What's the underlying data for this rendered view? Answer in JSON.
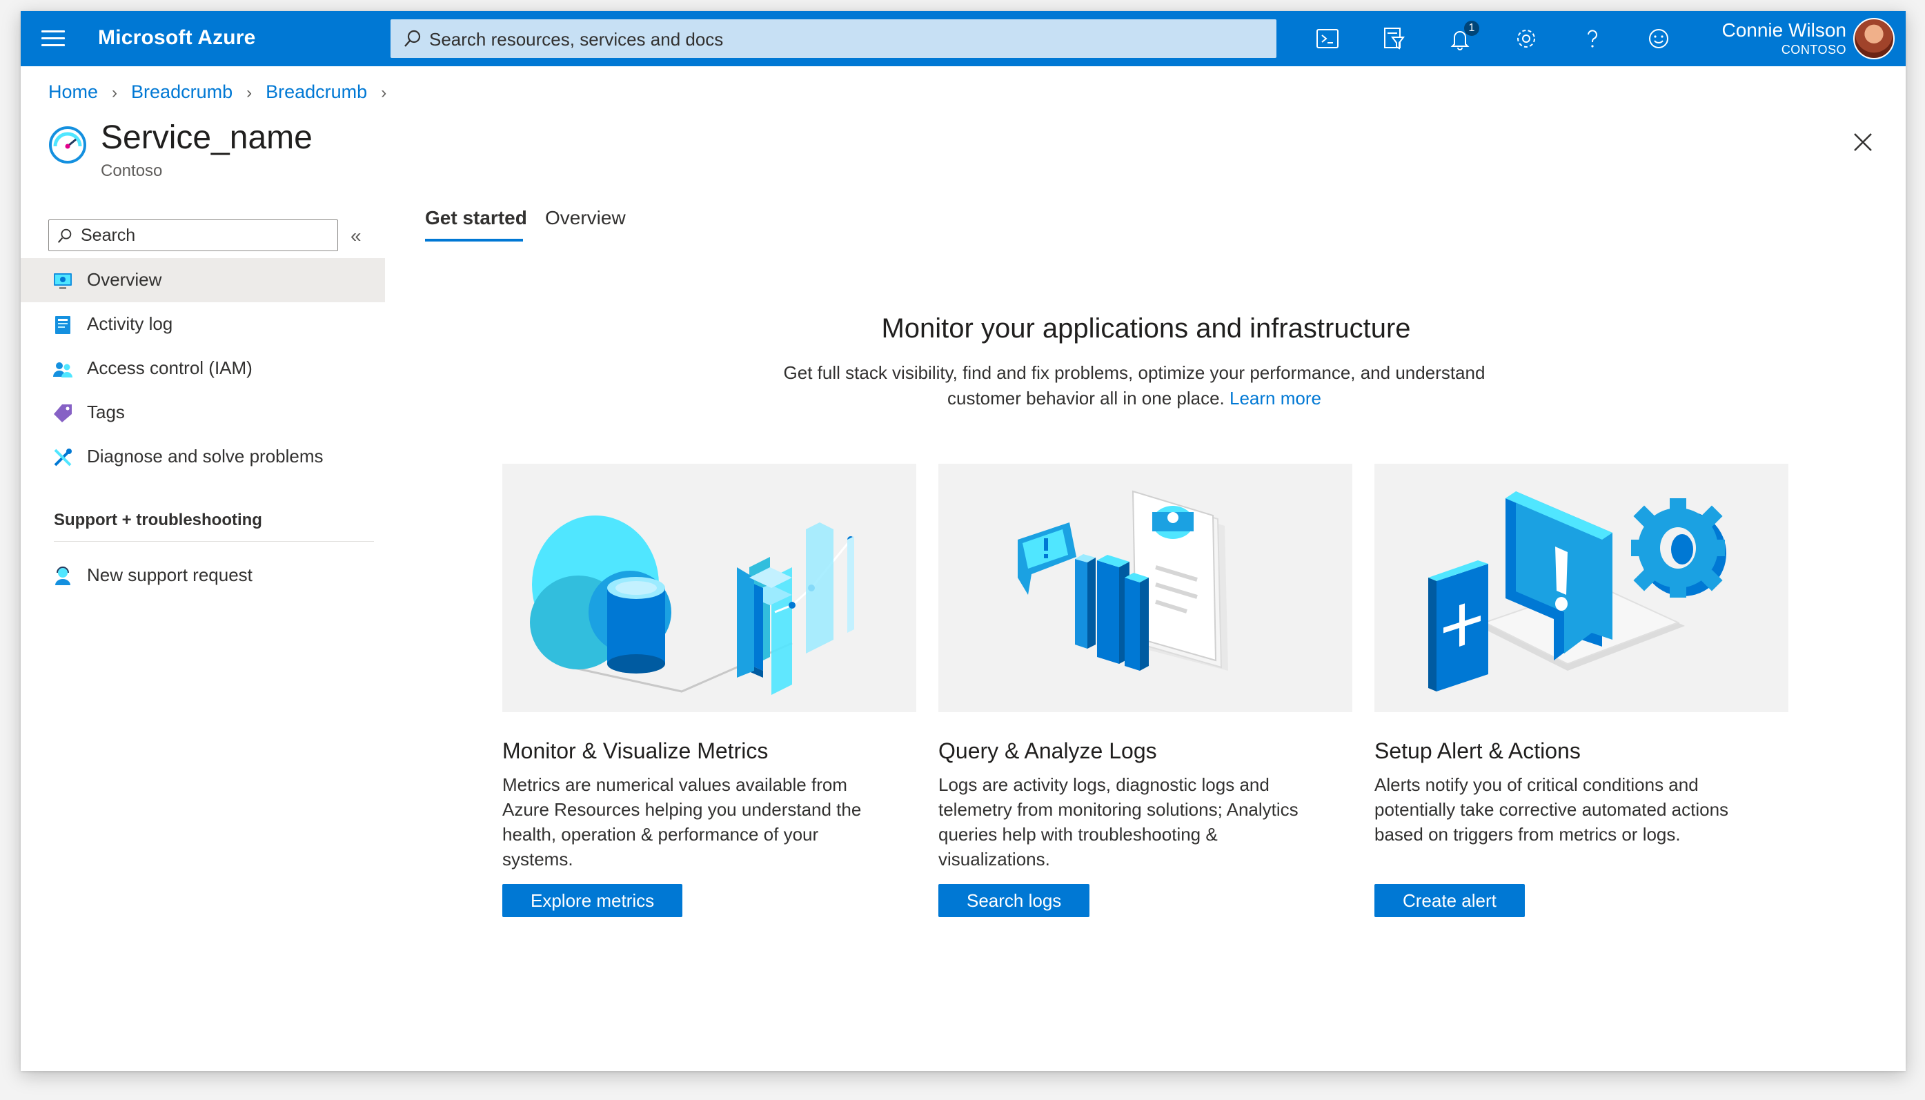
{
  "topbar": {
    "brand": "Microsoft Azure",
    "search_placeholder": "Search resources, services and docs",
    "notifications_count": "1",
    "user_name": "Connie Wilson",
    "user_org": "CONTOSO",
    "icons": [
      "cloud-shell-icon",
      "directory-filter-icon",
      "bell-icon",
      "gear-icon",
      "help-icon",
      "feedback-smiley-icon"
    ]
  },
  "breadcrumb": {
    "items": [
      "Home",
      "Breadcrumb",
      "Breadcrumb"
    ]
  },
  "resource": {
    "title": "Service_name",
    "subtitle": "Contoso"
  },
  "sidebar": {
    "search_placeholder": "Search",
    "items": [
      {
        "label": "Overview",
        "icon": "overview-monitor-icon",
        "active": true
      },
      {
        "label": "Activity log",
        "icon": "activity-log-icon",
        "active": false
      },
      {
        "label": "Access control (IAM)",
        "icon": "people-icon",
        "active": false
      },
      {
        "label": "Tags",
        "icon": "tag-icon",
        "active": false
      },
      {
        "label": "Diagnose and solve problems",
        "icon": "wrench-icon",
        "active": false
      }
    ],
    "section_heading": "Support + troubleshooting",
    "section_items": [
      {
        "label": "New support request",
        "icon": "support-person-icon"
      }
    ]
  },
  "tabs": [
    {
      "label": "Get started",
      "active": true
    },
    {
      "label": "Overview",
      "active": false
    }
  ],
  "hero": {
    "title": "Monitor your applications and infrastructure",
    "description": "Get full stack visibility, find and fix problems, optimize your performance, and understand customer behavior all in one place.",
    "link": "Learn more"
  },
  "cards": [
    {
      "title": "Monitor & Visualize Metrics",
      "description": "Metrics are numerical values available from Azure Resources helping you understand the health, operation & performance of your systems.",
      "button": "Explore metrics",
      "art": "metrics-illustration"
    },
    {
      "title": "Query & Analyze Logs",
      "description": "Logs are activity logs, diagnostic logs and telemetry from monitoring solutions; Analytics queries help with troubleshooting & visualizations.",
      "button": "Search logs",
      "art": "logs-illustration"
    },
    {
      "title": "Setup Alert & Actions",
      "description": "Alerts notify you of critical conditions and potentially take corrective automated actions based on triggers from metrics or logs.",
      "button": "Create alert",
      "art": "alerts-illustration"
    }
  ],
  "colors": {
    "accent": "#0078d4",
    "topbar": "#0078d4",
    "search_bg": "#c7e0f4",
    "active_nav": "#edebe9"
  }
}
